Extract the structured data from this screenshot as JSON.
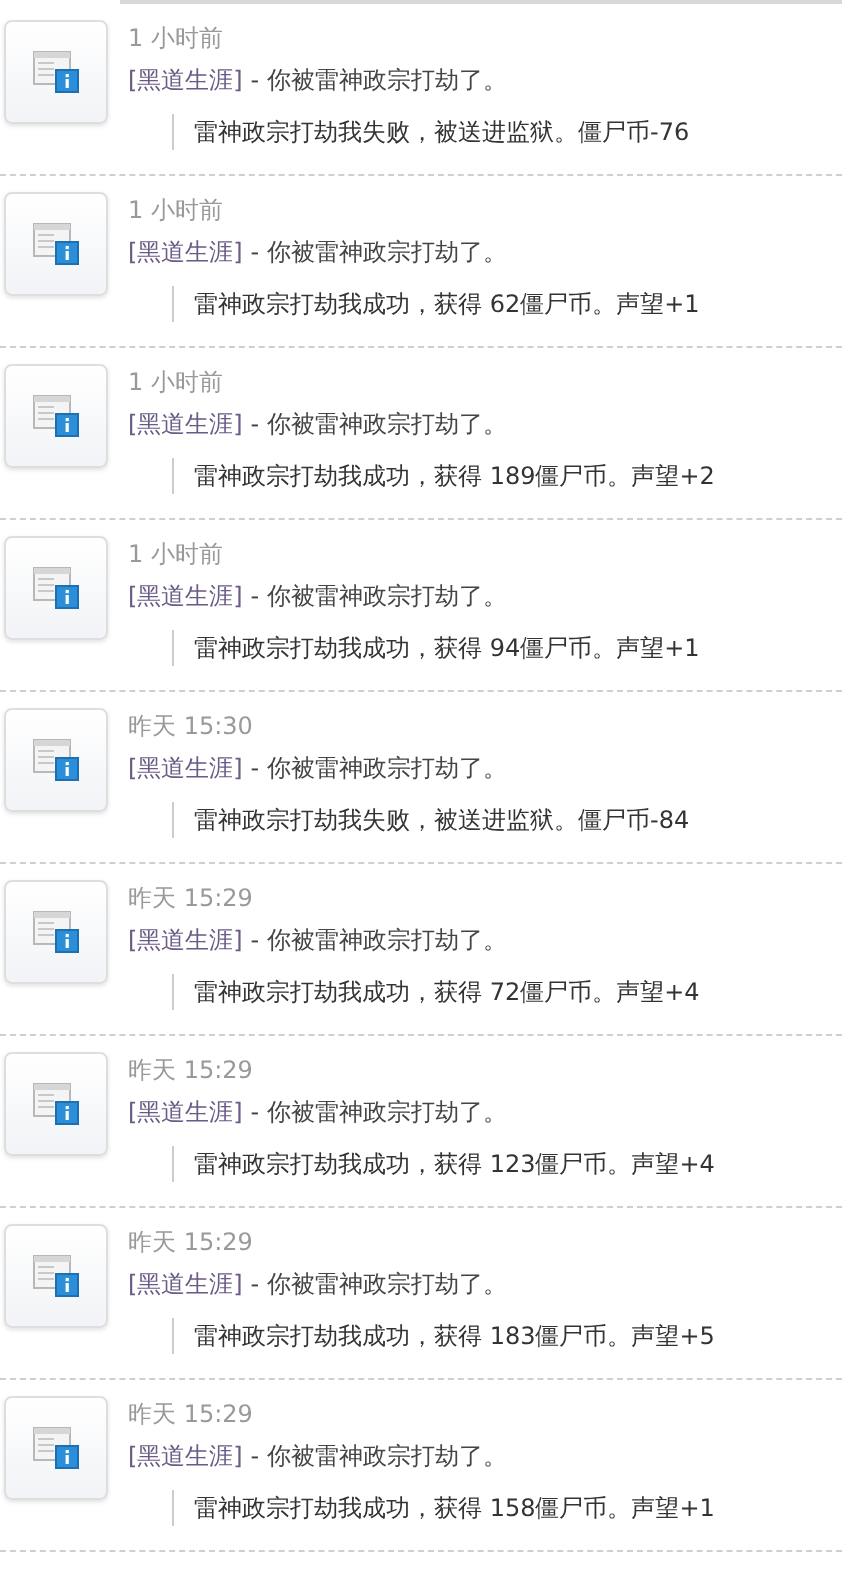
{
  "feed": [
    {
      "time": "1 小时前",
      "category": "[黑道生涯]",
      "message": " - 你被雷神政宗打劫了。",
      "detail": "雷神政宗打劫我失败，被送进监狱。僵尸币-76"
    },
    {
      "time": "1 小时前",
      "category": "[黑道生涯]",
      "message": " - 你被雷神政宗打劫了。",
      "detail": "雷神政宗打劫我成功，获得 62僵尸币。声望+1"
    },
    {
      "time": "1 小时前",
      "category": "[黑道生涯]",
      "message": " - 你被雷神政宗打劫了。",
      "detail": "雷神政宗打劫我成功，获得 189僵尸币。声望+2"
    },
    {
      "time": "1 小时前",
      "category": "[黑道生涯]",
      "message": " - 你被雷神政宗打劫了。",
      "detail": "雷神政宗打劫我成功，获得 94僵尸币。声望+1"
    },
    {
      "time": "昨天 15:30",
      "category": "[黑道生涯]",
      "message": " - 你被雷神政宗打劫了。",
      "detail": "雷神政宗打劫我失败，被送进监狱。僵尸币-84"
    },
    {
      "time": "昨天 15:29",
      "category": "[黑道生涯]",
      "message": " - 你被雷神政宗打劫了。",
      "detail": "雷神政宗打劫我成功，获得 72僵尸币。声望+4"
    },
    {
      "time": "昨天 15:29",
      "category": "[黑道生涯]",
      "message": " - 你被雷神政宗打劫了。",
      "detail": "雷神政宗打劫我成功，获得 123僵尸币。声望+4"
    },
    {
      "time": "昨天 15:29",
      "category": "[黑道生涯]",
      "message": " - 你被雷神政宗打劫了。",
      "detail": "雷神政宗打劫我成功，获得 183僵尸币。声望+5"
    },
    {
      "time": "昨天 15:29",
      "category": "[黑道生涯]",
      "message": " - 你被雷神政宗打劫了。",
      "detail": "雷神政宗打劫我成功，获得 158僵尸币。声望+1"
    }
  ]
}
